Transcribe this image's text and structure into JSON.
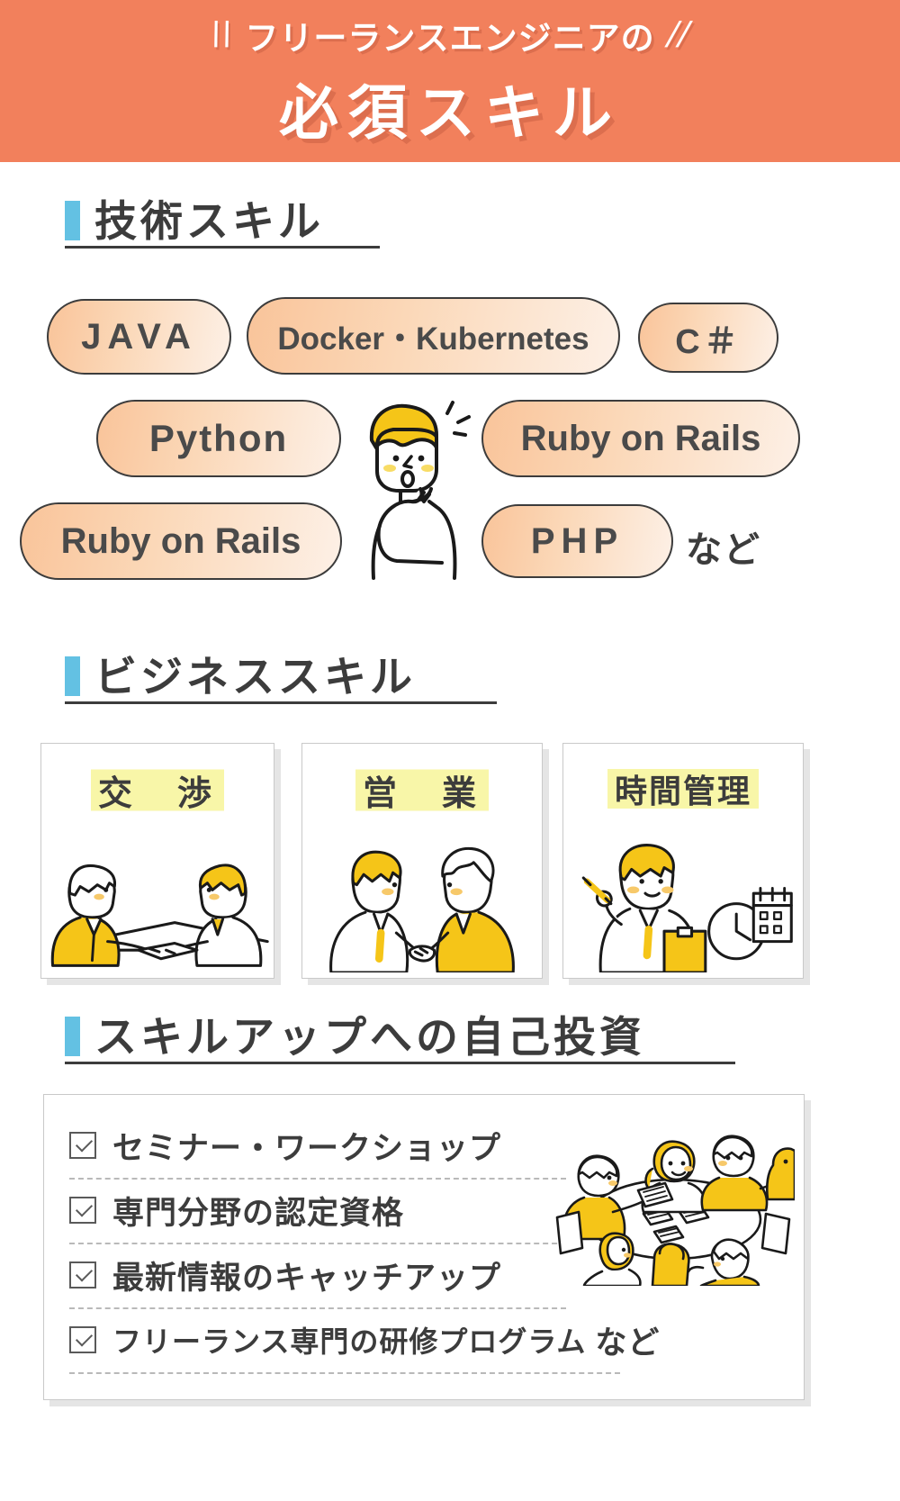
{
  "header": {
    "kicker": "フリーランスエンジニアの",
    "title": "必須スキル",
    "slash_left": "\\\\",
    "slash_right": "//",
    "bg_color": "#f2805c"
  },
  "sections": {
    "tech": {
      "heading": "技術スキル",
      "accent_color": "#63c1e3",
      "pills": [
        {
          "label": "JAVA"
        },
        {
          "label": "Docker・Kubernetes"
        },
        {
          "label": "C＃"
        },
        {
          "label": "Python"
        },
        {
          "label": "Ruby on Rails"
        },
        {
          "label": "Ruby on Rails"
        },
        {
          "label": "PHP"
        }
      ],
      "suffix": "など"
    },
    "business": {
      "heading": "ビジネススキル",
      "accent_color": "#63c1e3",
      "highlight_color": "#f8f6a8",
      "cards": [
        {
          "label": "交　渉",
          "art": "negotiation-illustration"
        },
        {
          "label": "営　業",
          "art": "handshake-illustration"
        },
        {
          "label": "時間管理",
          "art": "time-management-illustration"
        }
      ]
    },
    "investment": {
      "heading": "スキルアップへの自己投資",
      "accent_color": "#63c1e3",
      "items": [
        {
          "text": "セミナー・ワークショップ",
          "suffix": ""
        },
        {
          "text": "専門分野の認定資格",
          "suffix": ""
        },
        {
          "text": "最新情報のキャッチアップ",
          "suffix": ""
        },
        {
          "text": "フリーランス専門の研修プログラム",
          "suffix": "など"
        }
      ],
      "art": "group-meeting-illustration"
    }
  },
  "palette": {
    "orange": "#f2805c",
    "blue_accent": "#63c1e3",
    "yellow": "#f5c518",
    "highlight_yellow": "#f8f6a8",
    "ink": "#3c3c3c",
    "pill_gradient_start": "#f9c49a",
    "pill_gradient_end": "#fdf0e6"
  }
}
